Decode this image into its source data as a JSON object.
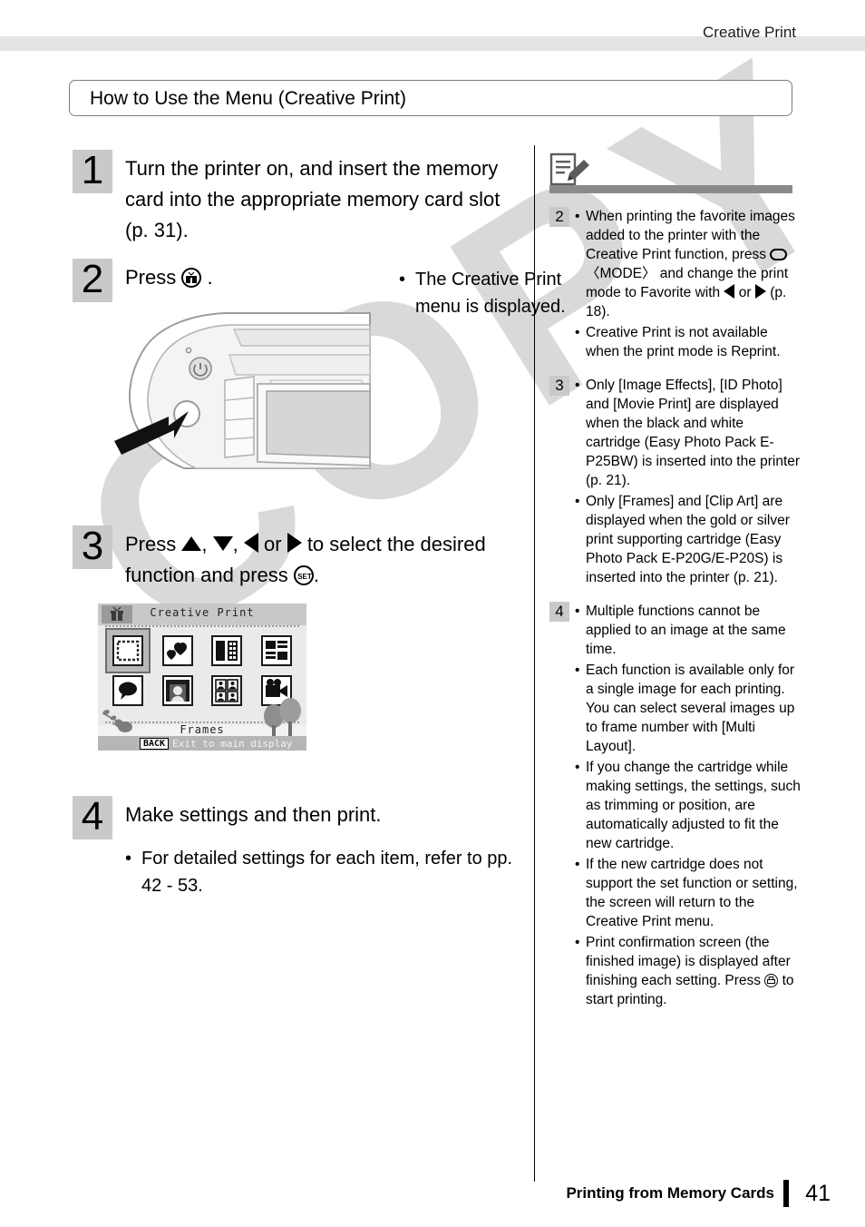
{
  "header": {
    "running_head": "Creative Print"
  },
  "section": {
    "title": "How to Use the Menu (Creative Print)"
  },
  "steps": [
    {
      "number": "1",
      "text": "Turn the printer on, and insert the memory card into the appropriate memory card slot (p. 31)."
    },
    {
      "number": "2",
      "text_before": "Press",
      "icon": "creative-print-button-icon",
      "text_after": ".",
      "note_bullet": "The Creative Print menu is displayed."
    },
    {
      "number": "3",
      "text_1": "Press",
      "icon_up": "up-arrow-icon",
      "sep_1": ",",
      "icon_down": "down-arrow-icon",
      "sep_2": ",",
      "icon_left": "left-arrow-icon",
      "text_or": "or",
      "icon_right": "right-arrow-icon",
      "text_2": "to select the desired function and press",
      "icon_set": "set-button-icon",
      "text_3": "."
    },
    {
      "number": "4",
      "text": "Make settings and then print.",
      "note_bullet": "For detailed settings for each item, refer to pp. 42 - 53."
    }
  ],
  "lcd": {
    "title": "Creative Print",
    "selected_label": "Frames",
    "back_key": "BACK",
    "back_text": "Exit to main display",
    "tiles_row1": [
      "frames-icon",
      "clip-art-icon",
      "multi-layout-icon",
      "image-effects-icon"
    ],
    "tiles_row2": [
      "speech-balloon-icon",
      "calendar-icon",
      "id-photo-icon",
      "movie-print-icon"
    ]
  },
  "notes": {
    "icon": "memo-pencil-icon",
    "blocks": [
      {
        "number": "2",
        "items": [
          {
            "parts": [
              {
                "t": "text",
                "v": "When printing the favorite images added to the printer with the Creative Print function, press "
              },
              {
                "t": "icon",
                "v": "mode-button-icon"
              },
              {
                "t": "text",
                "v": " 〈MODE〉 and change the print mode to Favorite with "
              },
              {
                "t": "icon",
                "v": "left-arrow-icon"
              },
              {
                "t": "text",
                "v": " or "
              },
              {
                "t": "icon",
                "v": "right-arrow-icon"
              },
              {
                "t": "text",
                "v": " (p. 18)."
              }
            ]
          },
          {
            "parts": [
              {
                "t": "text",
                "v": "Creative Print is not available when the print mode is Reprint."
              }
            ]
          }
        ]
      },
      {
        "number": "3",
        "items": [
          {
            "parts": [
              {
                "t": "text",
                "v": "Only [Image Effects], [ID Photo] and [Movie Print] are displayed when the black and white cartridge (Easy Photo Pack E-P25BW) is inserted into the printer (p. 21)."
              }
            ]
          },
          {
            "parts": [
              {
                "t": "text",
                "v": "Only [Frames] and [Clip Art] are displayed when the gold or silver print supporting cartridge (Easy Photo Pack E-P20G/E-P20S) is inserted into the printer (p. 21)."
              }
            ]
          }
        ]
      },
      {
        "number": "4",
        "items": [
          {
            "parts": [
              {
                "t": "text",
                "v": "Multiple functions cannot be applied to an image at the same time."
              }
            ]
          },
          {
            "parts": [
              {
                "t": "text",
                "v": "Each function is available only for a single image for each printing. You can select several images up to frame number with [Multi Layout]."
              }
            ]
          },
          {
            "parts": [
              {
                "t": "text",
                "v": "If you change the cartridge while making settings, the settings, such as trimming or position, are automatically adjusted to fit the new cartridge."
              }
            ]
          },
          {
            "parts": [
              {
                "t": "text",
                "v": "If the new cartridge does not support the set function or setting, the screen will return to the Creative Print menu."
              }
            ]
          },
          {
            "parts": [
              {
                "t": "text",
                "v": "Print confirmation screen (the finished image) is displayed after finishing each setting. Press "
              },
              {
                "t": "icon",
                "v": "print-button-icon"
              },
              {
                "t": "text",
                "v": " to start printing."
              }
            ]
          }
        ]
      }
    ]
  },
  "footer": {
    "chapter": "Printing from Memory Cards",
    "page": "41"
  },
  "watermark": {
    "text": "COPY"
  },
  "colors": {
    "step_number_bg": "#c9c9c9",
    "header_band": "#e4e4e4",
    "watermark": "#d9d9d9",
    "note_bar": "#8a8a8a"
  }
}
